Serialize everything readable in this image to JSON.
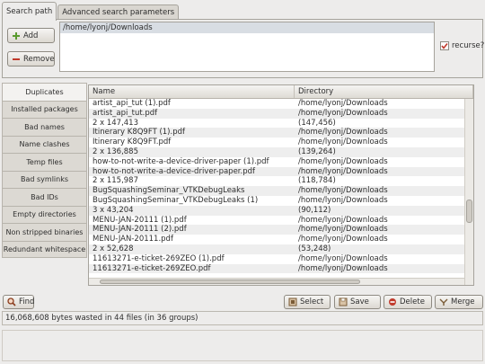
{
  "tabs": [
    {
      "label": "Search path"
    },
    {
      "label": "Advanced search parameters"
    }
  ],
  "search_path": {
    "add_label": "Add",
    "remove_label": "Remove",
    "paths": [
      "/home/lyonj/Downloads"
    ],
    "recurse_label": "recurse?",
    "recurse_checked": true
  },
  "sidebar": {
    "items": [
      {
        "label": "Duplicates"
      },
      {
        "label": "Installed packages"
      },
      {
        "label": "Bad names"
      },
      {
        "label": "Name clashes"
      },
      {
        "label": "Temp files"
      },
      {
        "label": "Bad symlinks"
      },
      {
        "label": "Bad IDs"
      },
      {
        "label": "Empty directories"
      },
      {
        "label": "Non stripped binaries"
      },
      {
        "label": "Redundant whitespace"
      }
    ]
  },
  "table": {
    "columns": [
      "Name",
      "Directory"
    ],
    "rows": [
      {
        "name": "artist_api_tut (1).pdf",
        "dir": "/home/lyonj/Downloads"
      },
      {
        "name": "artist_api_tut.pdf",
        "dir": "/home/lyonj/Downloads"
      },
      {
        "name": "2 x 147,413",
        "dir": "(147,456)"
      },
      {
        "name": "Itinerary K8Q9FT (1).pdf",
        "dir": "/home/lyonj/Downloads"
      },
      {
        "name": "Itinerary K8Q9FT.pdf",
        "dir": "/home/lyonj/Downloads"
      },
      {
        "name": "2 x 136,885",
        "dir": "(139,264)"
      },
      {
        "name": "how-to-not-write-a-device-driver-paper (1).pdf",
        "dir": "/home/lyonj/Downloads"
      },
      {
        "name": "how-to-not-write-a-device-driver-paper.pdf",
        "dir": "/home/lyonj/Downloads"
      },
      {
        "name": "2 x 115,987",
        "dir": "(118,784)"
      },
      {
        "name": "BugSquashingSeminar_VTKDebugLeaks",
        "dir": "/home/lyonj/Downloads"
      },
      {
        "name": "BugSquashingSeminar_VTKDebugLeaks (1)",
        "dir": "/home/lyonj/Downloads"
      },
      {
        "name": "3 x 43,204",
        "dir": "(90,112)"
      },
      {
        "name": "MENU-JAN-20111 (1).pdf",
        "dir": "/home/lyonj/Downloads"
      },
      {
        "name": "MENU-JAN-20111 (2).pdf",
        "dir": "/home/lyonj/Downloads"
      },
      {
        "name": "MENU-JAN-20111.pdf",
        "dir": "/home/lyonj/Downloads"
      },
      {
        "name": "2 x 52,628",
        "dir": "(53,248)"
      },
      {
        "name": "11613271-e-ticket-269ZEO (1).pdf",
        "dir": "/home/lyonj/Downloads"
      },
      {
        "name": "11613271-e-ticket-269ZEO.pdf",
        "dir": "/home/lyonj/Downloads"
      }
    ]
  },
  "actions": {
    "find_label": "Find",
    "select_label": "Select",
    "save_label": "Save",
    "delete_label": "Delete",
    "merge_label": "Merge"
  },
  "status": {
    "text": "16,068,608 bytes wasted in 44 files (in 36 groups)"
  },
  "colors": {
    "add_icon": "#5a9a2e",
    "remove_icon": "#c0392b",
    "delete_icon": "#c0392b",
    "selected_row": "#d8dde3"
  },
  "icons": {
    "add": "plus-icon",
    "remove": "minus-icon",
    "find": "magnifier-icon",
    "select": "select-icon",
    "save": "save-icon",
    "delete": "delete-icon",
    "merge": "merge-icon"
  }
}
